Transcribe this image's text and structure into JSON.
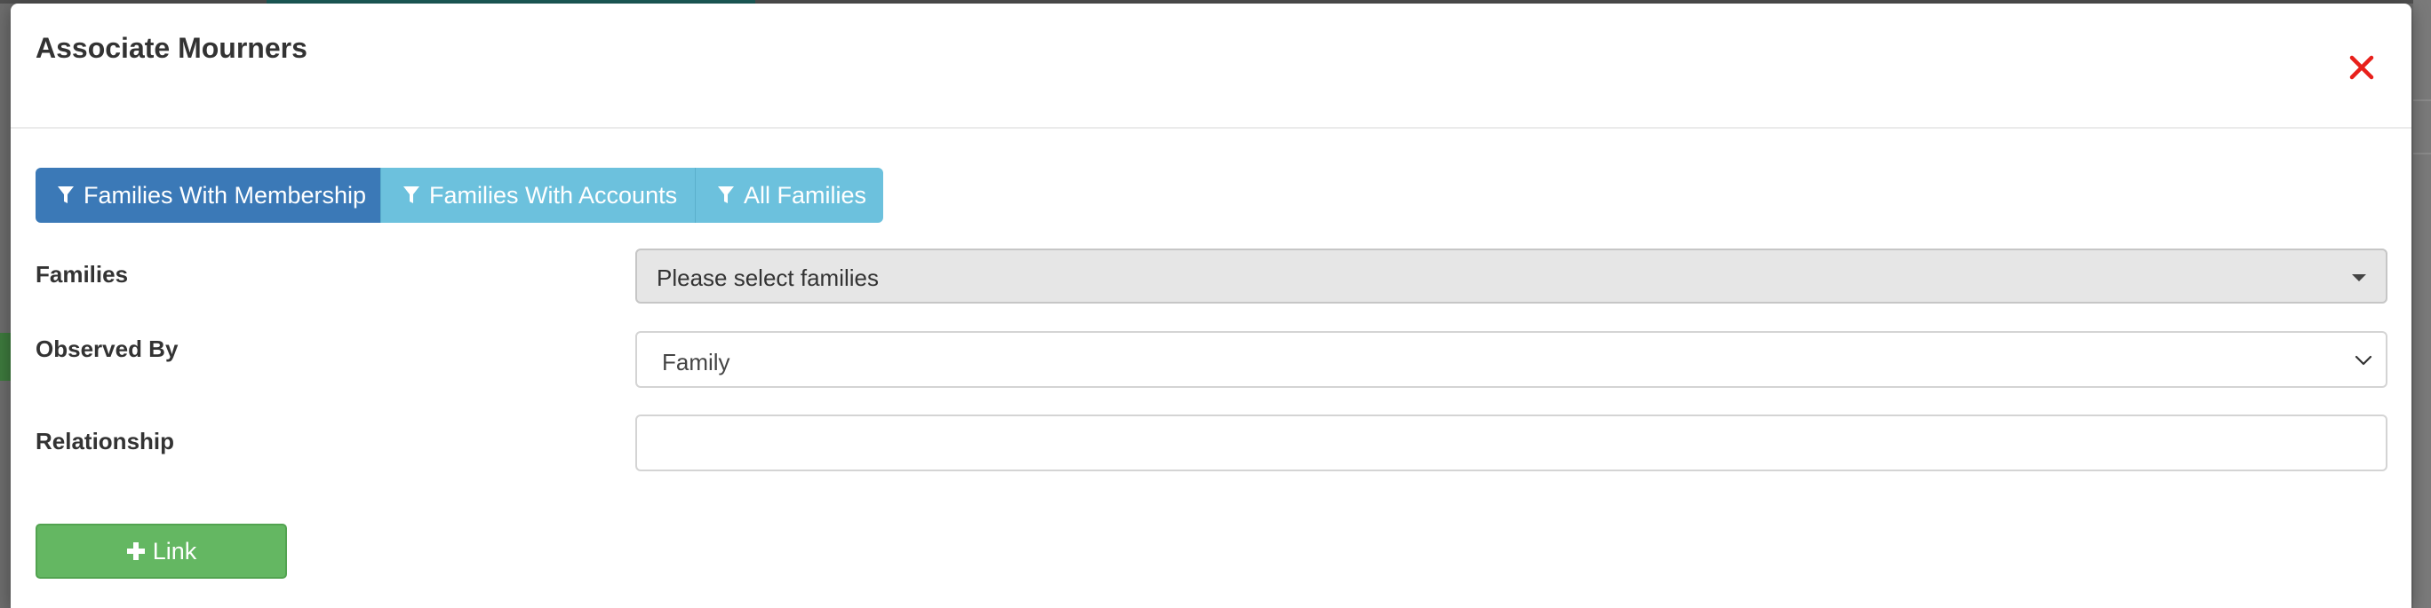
{
  "modal": {
    "title": "Associate Mourners"
  },
  "filters": {
    "items": [
      {
        "label": "Families With Membership",
        "active": true
      },
      {
        "label": "Families With Accounts",
        "active": false
      },
      {
        "label": "All Families",
        "active": false
      }
    ],
    "icon": "filter-icon"
  },
  "form": {
    "families": {
      "label": "Families",
      "placeholder": "Please select families"
    },
    "observed_by": {
      "label": "Observed By",
      "value": "Family"
    },
    "relationship": {
      "label": "Relationship",
      "value": ""
    }
  },
  "actions": {
    "link_label": "Link",
    "link_icon": "plus-icon"
  },
  "colors": {
    "primary": "#3b79b7",
    "info": "#6cc1dd",
    "success": "#64b762",
    "danger": "#e8201b"
  }
}
